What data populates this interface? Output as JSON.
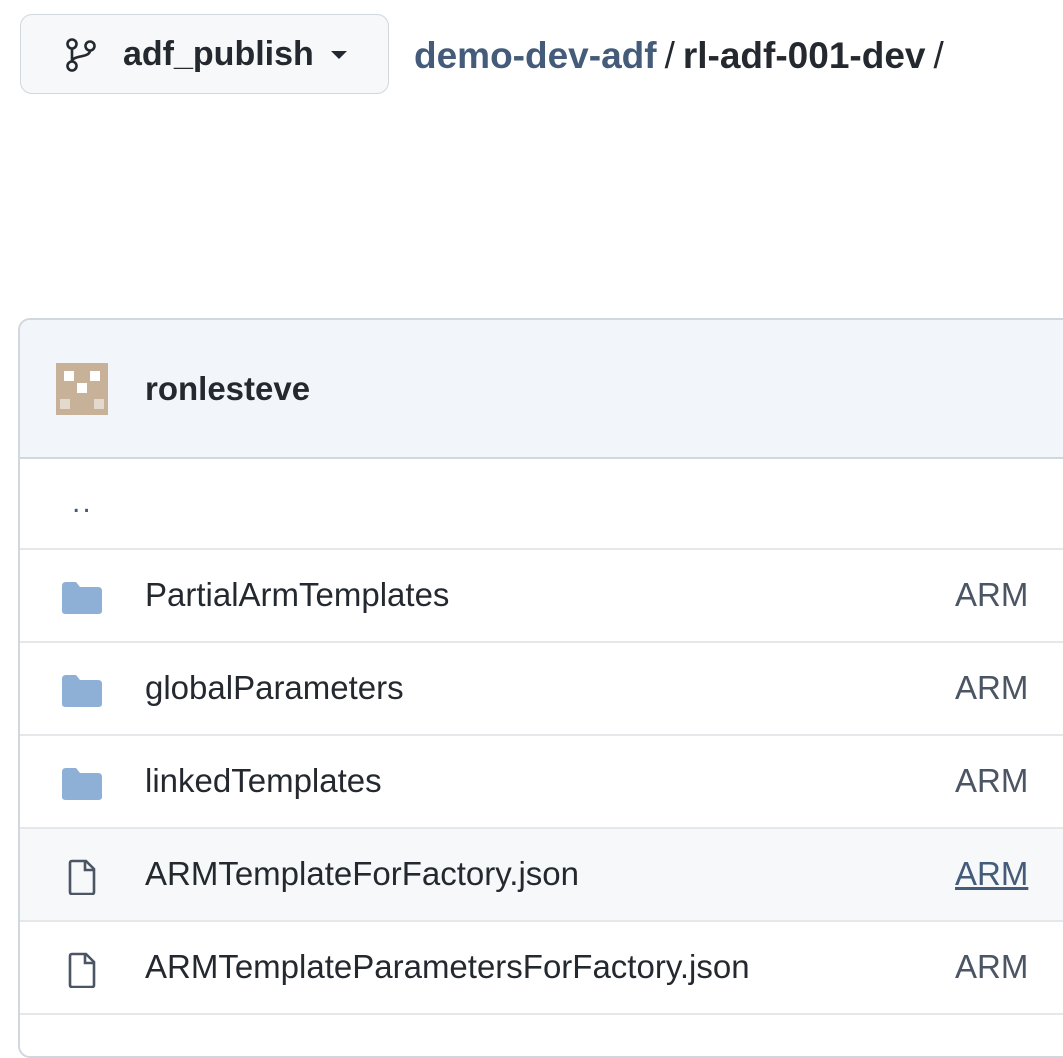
{
  "branch": {
    "name": "adf_publish",
    "icon": "git-branch-icon"
  },
  "breadcrumb": {
    "repo": "demo-dev-adf",
    "sep1": "/",
    "folder": "rl-adf-001-dev",
    "sep2": "/"
  },
  "commit_header": {
    "author": "ronlesteve",
    "avatar_color": "#c7b299"
  },
  "parent_dir": "..",
  "files": [
    {
      "type": "folder",
      "name": "PartialArmTemplates",
      "commit": "ARM"
    },
    {
      "type": "folder",
      "name": "globalParameters",
      "commit": "ARM"
    },
    {
      "type": "folder",
      "name": "linkedTemplates",
      "commit": "ARM"
    },
    {
      "type": "file",
      "name": "ARMTemplateForFactory.json",
      "commit": "ARM"
    },
    {
      "type": "file",
      "name": "ARMTemplateParametersForFactory.json",
      "commit": "ARM"
    }
  ],
  "colors": {
    "folder": "#8fb0d6",
    "link": "#445b7a",
    "border": "#d0d7de",
    "header_bg": "#f2f5f9"
  }
}
